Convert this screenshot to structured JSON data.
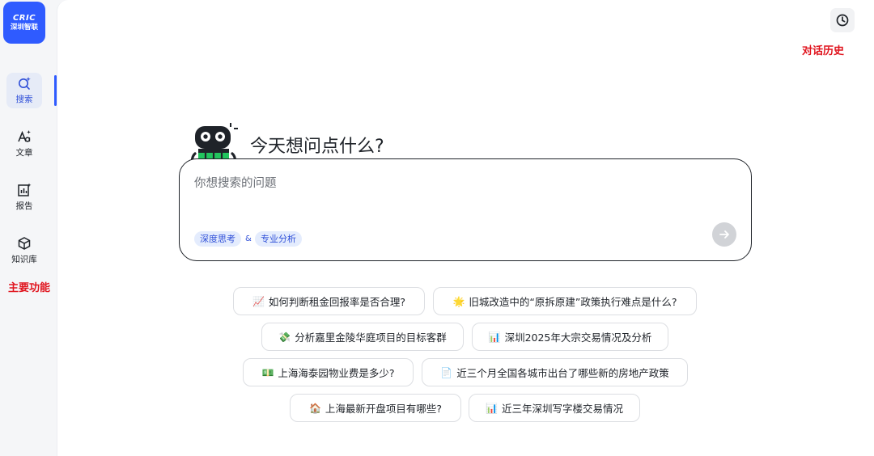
{
  "logo": {
    "brand": "CRIC",
    "subtitle": "深圳智联"
  },
  "nav": {
    "items": [
      {
        "label": "搜索",
        "icon": "search-spark-icon",
        "active": true
      },
      {
        "label": "文章",
        "icon": "article-spark-icon",
        "active": false
      },
      {
        "label": "报告",
        "icon": "report-chart-icon",
        "active": false
      },
      {
        "label": "知识库",
        "icon": "knowledge-cube-icon",
        "active": false
      }
    ]
  },
  "annotations": {
    "main_features": "主要功能",
    "chat_history": "对话历史"
  },
  "header": {
    "history_icon": "clock-history-icon"
  },
  "greeting": "今天想问点什么?",
  "search": {
    "placeholder": "你想搜索的问题",
    "value": "",
    "tags": [
      "深度思考",
      "专业分析"
    ],
    "tag_separator": "&"
  },
  "suggestions": [
    {
      "emoji": "📈",
      "text": "如何判断租金回报率是否合理?"
    },
    {
      "emoji": "🌟",
      "text": "旧城改造中的“原拆原建”政策执行难点是什么?"
    },
    {
      "emoji": "💸",
      "text": "分析嘉里金陵华庭项目的目标客群"
    },
    {
      "emoji": "📊",
      "text": "深圳2025年大宗交易情况及分析"
    },
    {
      "emoji": "💵",
      "text": "上海海泰园物业费是多少?"
    },
    {
      "emoji": "📄",
      "text": "近三个月全国各城市出台了哪些新的房地产政策"
    },
    {
      "emoji": "🏠",
      "text": "上海最新开盘项目有哪些?"
    },
    {
      "emoji": "📊",
      "text": "近三年深圳写字楼交易情况"
    }
  ],
  "colors": {
    "accent": "#2f5bff",
    "annotation": "#e0141e",
    "robot_green": "#22c55e"
  }
}
